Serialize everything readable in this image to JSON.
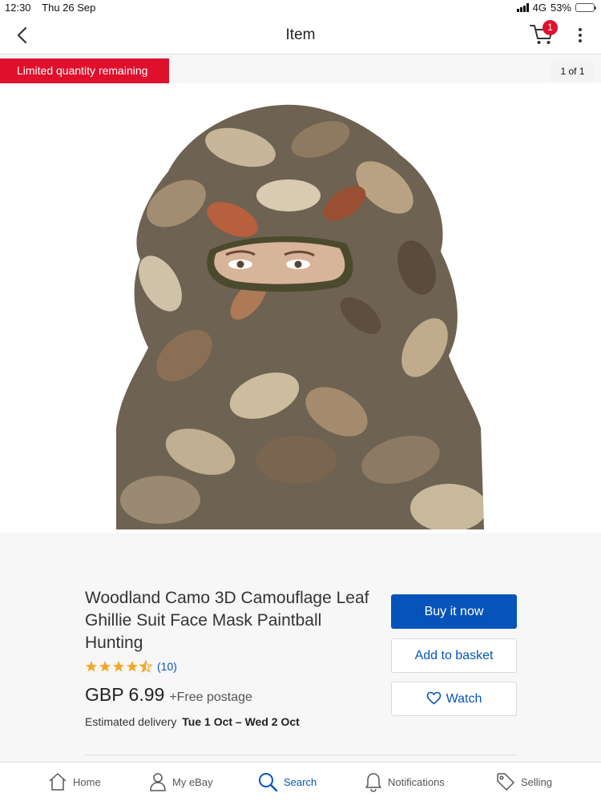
{
  "status_bar": {
    "time": "12:30",
    "date": "Thu 26 Sep",
    "network": "4G",
    "battery": "53%",
    "battery_level": 0.53
  },
  "header": {
    "title": "Item",
    "cart_count": "1",
    "back_icon": "chevron-left-icon",
    "cart_icon": "cart-icon",
    "more_icon": "more-vertical-icon"
  },
  "banner": {
    "limited": "Limited quantity remaining",
    "image_counter": "1 of 1"
  },
  "product": {
    "title": "Woodland Camo 3D Camouflage Leaf Ghillie Suit Face Mask Paintball Hunting",
    "rating": 4.5,
    "rating_count": "(10)",
    "price": "GBP 6.99",
    "postage": "+Free postage",
    "delivery_label": "Estimated delivery",
    "delivery_dates": "Tue 1 Oct – Wed 2 Oct"
  },
  "actions": {
    "buy_now": "Buy it now",
    "add_to_basket": "Add to basket",
    "watch": "Watch"
  },
  "colors": {
    "accent_blue": "#0654ba",
    "alert_red": "#e0102c",
    "star": "#f5a623"
  },
  "tabs": [
    {
      "label": "Home",
      "icon": "home-icon"
    },
    {
      "label": "My eBay",
      "icon": "person-icon"
    },
    {
      "label": "Search",
      "icon": "search-icon",
      "active": true
    },
    {
      "label": "Notifications",
      "icon": "bell-icon"
    },
    {
      "label": "Selling",
      "icon": "tag-icon"
    }
  ]
}
